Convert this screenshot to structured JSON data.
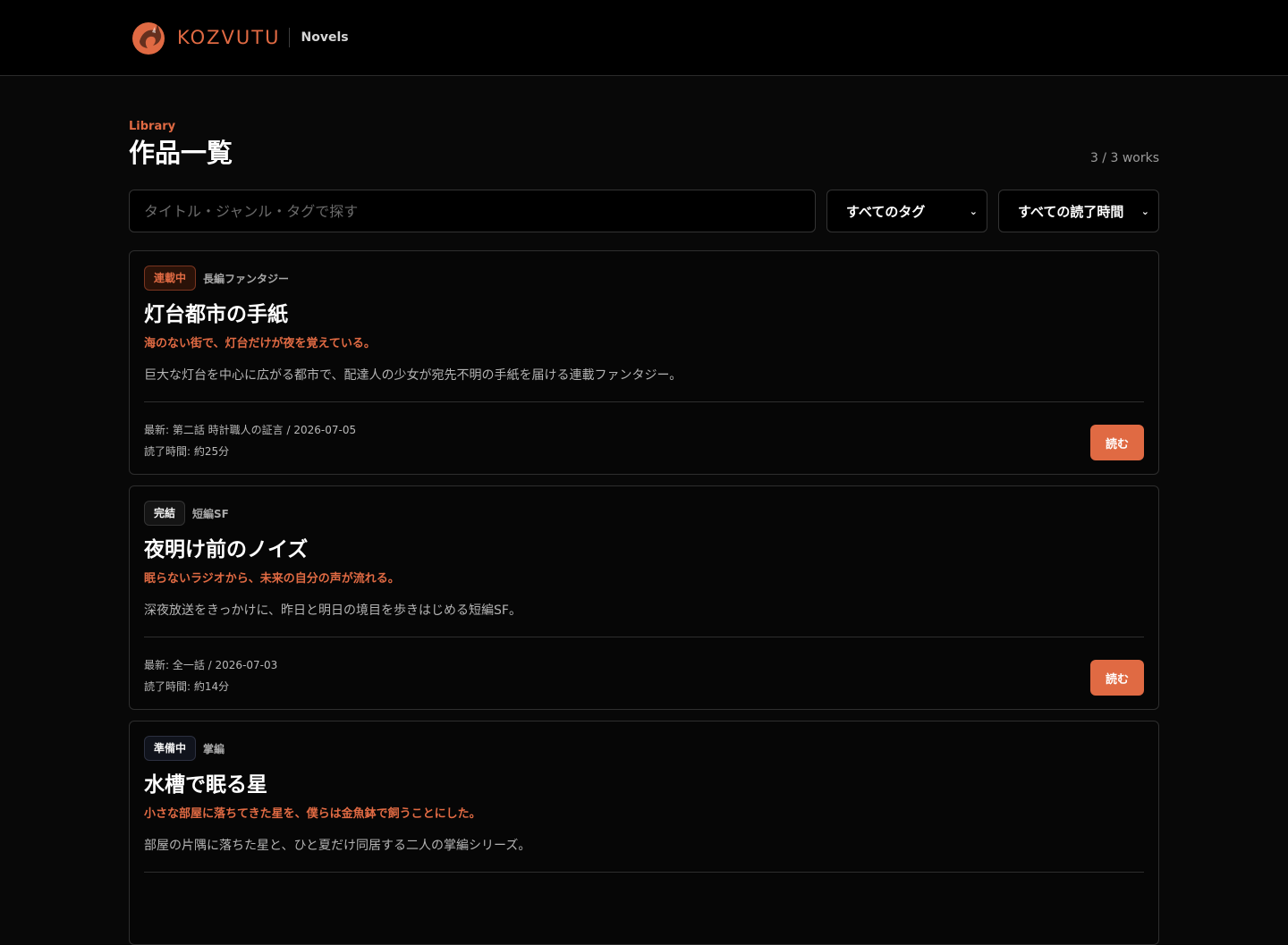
{
  "header": {
    "brand_name": "KOZVUTU",
    "section": "Novels",
    "accent_color": "#e06a43"
  },
  "library": {
    "eyebrow": "Library",
    "title": "作品一覧",
    "count": "3 / 3 works",
    "search_placeholder": "タイトル・ジャンル・タグで探す",
    "tag_filter": "すべてのタグ",
    "time_filter": "すべての読了時間"
  },
  "works": [
    {
      "status": "連載中",
      "genre": "長編ファンタジー",
      "title": "灯台都市の手紙",
      "tagline": "海のない街で、灯台だけが夜を覚えている。",
      "description": "巨大な灯台を中心に広がる都市で、配達人の少女が宛先不明の手紙を届ける連載ファンタジー。",
      "latest": "最新: 第二話 時計職人の証言 / 2026-07-05",
      "read_time": "読了時間: 約25分",
      "button": "読む"
    },
    {
      "status": "完結",
      "genre": "短編SF",
      "title": "夜明け前のノイズ",
      "tagline": "眠らないラジオから、未来の自分の声が流れる。",
      "description": "深夜放送をきっかけに、昨日と明日の境目を歩きはじめる短編SF。",
      "latest": "最新: 全一話 / 2026-07-03",
      "read_time": "読了時間: 約14分",
      "button": "読む"
    },
    {
      "status": "準備中",
      "genre": "掌編",
      "title": "水槽で眠る星",
      "tagline": "小さな部屋に落ちてきた星を、僕らは金魚鉢で飼うことにした。",
      "description": "部屋の片隅に落ちた星と、ひと夏だけ同居する二人の掌編シリーズ。",
      "latest": "",
      "read_time": "",
      "button": ""
    }
  ]
}
